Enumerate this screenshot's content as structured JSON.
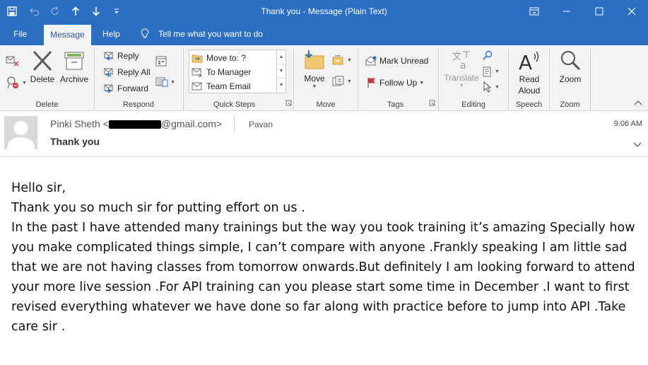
{
  "window": {
    "title": "Thank you  -  Message (Plain Text)"
  },
  "menu": {
    "tabs": [
      {
        "label": "File"
      },
      {
        "label": "Message"
      },
      {
        "label": "Help"
      }
    ],
    "tell_me": "Tell me what you want to do"
  },
  "ribbon": {
    "delete_group": {
      "label": "Delete",
      "delete": "Delete",
      "archive": "Archive"
    },
    "respond_group": {
      "label": "Respond",
      "reply": "Reply",
      "reply_all": "Reply All",
      "forward": "Forward"
    },
    "quick_steps_group": {
      "label": "Quick Steps",
      "items": [
        {
          "label": "Move to: ?"
        },
        {
          "label": "To Manager"
        },
        {
          "label": "Team Email"
        }
      ]
    },
    "move_group": {
      "label": "Move",
      "move": "Move"
    },
    "tags_group": {
      "label": "Tags",
      "mark_unread": "Mark Unread",
      "follow_up": "Follow Up"
    },
    "editing_group": {
      "label": "Editing",
      "translate": "Translate"
    },
    "speech_group": {
      "label": "Speech",
      "read_aloud_1": "Read",
      "read_aloud_2": "Aloud"
    },
    "zoom_group": {
      "label": "Zoom",
      "zoom": "Zoom"
    }
  },
  "message": {
    "sender_name": "Pinki Sheth",
    "sender_email_prefix": "<",
    "sender_email_suffix": "@gmail.com>",
    "recipient": "Pavan",
    "time": "9:06 AM",
    "subject": "Thank you",
    "body": [
      "Hello sir,",
      "Thank you so much sir for putting effort on us .",
      "In the past I have attended many trainings but the way you took training it’s amazing Specially how you make complicated things simple, I can’t compare with anyone .Frankly speaking I am little sad that we are not having classes from tomorrow onwards.But definitely I am looking forward to attend your more live session .For API training can you please start some time in December .I want to first revised everything whatever we have done so far along with practice before to jump into API .Take care sir ."
    ]
  },
  "colors": {
    "title_bar": "#2b6fc2",
    "ribbon": "#f3f3f3",
    "follow_up_flag": "#d13438"
  }
}
